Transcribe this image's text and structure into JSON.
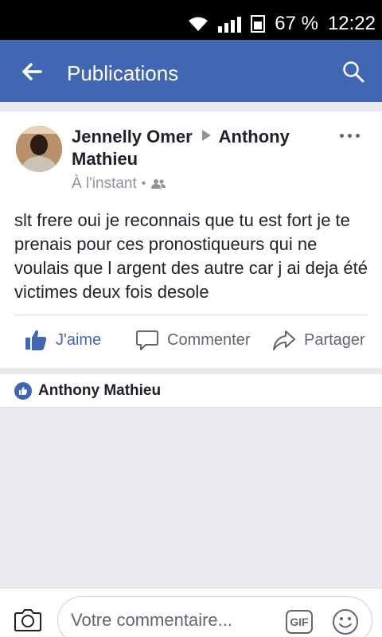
{
  "status_bar": {
    "battery_percent": "67 %",
    "time": "12:22"
  },
  "app_bar": {
    "title": "Publications",
    "back_icon": "arrow-left-icon",
    "search_icon": "search-icon"
  },
  "post": {
    "author": "Jennelly Omer",
    "target": "Anthony Mathieu",
    "timestamp": "À l'instant",
    "separator": "•",
    "audience_icon": "friends-icon",
    "text": "slt frere oui je reconnais que tu est fort je te prenais pour ces pronostiqueurs qui ne voulais que l argent des autre car j ai deja été victimes deux fois desole",
    "actions": {
      "like": "J'aime",
      "comment": "Commenter",
      "share": "Partager"
    }
  },
  "reactions": {
    "name": "Anthony Mathieu"
  },
  "composer": {
    "placeholder": "Votre commentaire...",
    "gif_label": "GIF"
  },
  "colors": {
    "brand": "#4267b2",
    "background": "#e9ebee",
    "text": "#1d2129",
    "muted": "#606770"
  }
}
